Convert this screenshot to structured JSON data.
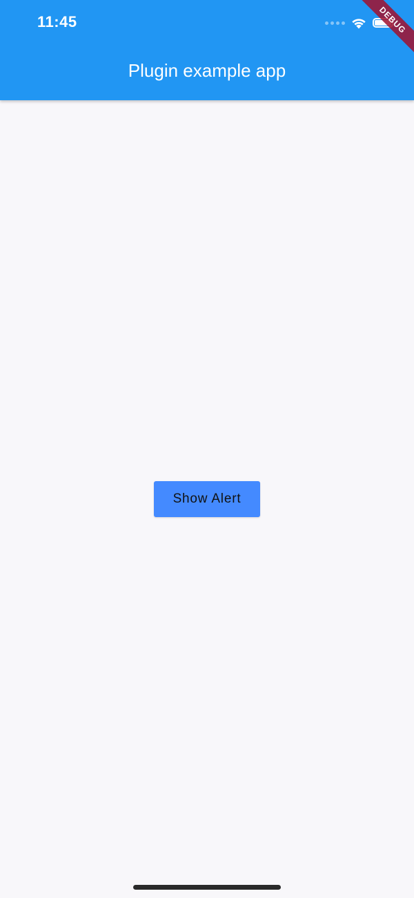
{
  "status_bar": {
    "time": "11:45",
    "icons": [
      "cellular-dots-icon",
      "wifi-icon",
      "battery-icon"
    ]
  },
  "app_bar": {
    "title": "Plugin example app",
    "color": "#2196f3"
  },
  "debug_banner": {
    "label": "DEBUG",
    "color": "#a1102d"
  },
  "main": {
    "button_label": "Show Alert",
    "button_color": "#448aff"
  },
  "background_color": "#f8f7fa"
}
